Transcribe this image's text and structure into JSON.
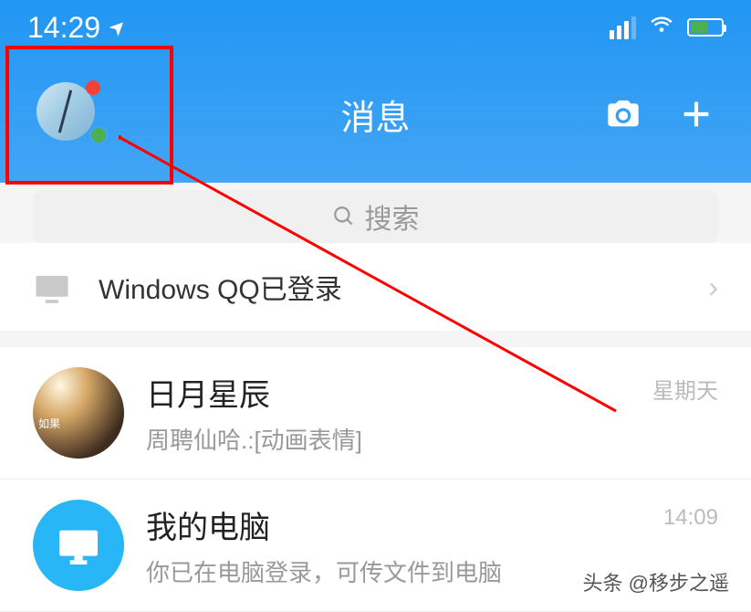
{
  "status": {
    "time": "14:29"
  },
  "header": {
    "title": "消息"
  },
  "search": {
    "placeholder": "搜索"
  },
  "login_notice": {
    "text": "Windows QQ已登录"
  },
  "chats": [
    {
      "name": "日月星辰",
      "preview": "周聘仙哈.:[动画表情]",
      "time": "星期天"
    },
    {
      "name": "我的电脑",
      "preview": "你已在电脑登录，可传文件到电脑",
      "time": "14:09"
    }
  ],
  "watermark": "头条 @移步之遥"
}
